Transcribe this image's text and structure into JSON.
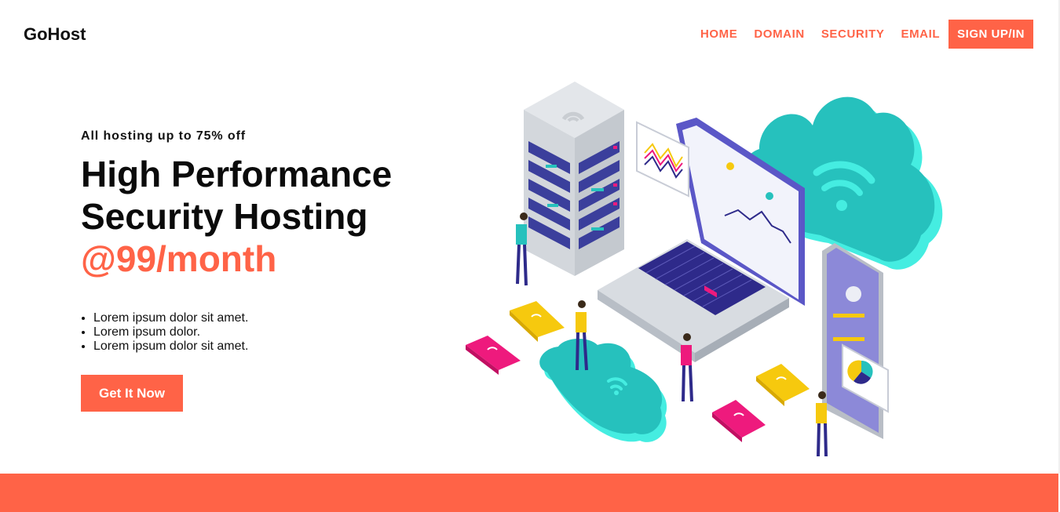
{
  "brand": {
    "name": "GoHost"
  },
  "nav": {
    "items": [
      {
        "label": "HOME"
      },
      {
        "label": "DOMAIN"
      },
      {
        "label": "SECURITY"
      },
      {
        "label": "EMAIL"
      }
    ],
    "cta_label": "SIGN UP/IN"
  },
  "hero": {
    "eyebrow": "All hosting up to 75% off",
    "headline_line1": "High Performance",
    "headline_line2": "Security Hosting",
    "price": "@99/month",
    "bullets": [
      "Lorem ipsum dolor sit amet.",
      "Lorem ipsum dolor.",
      "Lorem ipsum dolor sit amet."
    ],
    "cta_label": "Get It Now"
  },
  "colors": {
    "accent": "#ff6347",
    "teal": "#26c1bd",
    "navy": "#2e2a8a",
    "yellow": "#f6c90e",
    "pink": "#ee1a7d"
  },
  "illustration": {
    "icons": [
      "server-rack-icon",
      "laptop-icon",
      "cloud-icon",
      "phone-icon",
      "folder-icon",
      "wifi-icon",
      "person-icon"
    ]
  }
}
